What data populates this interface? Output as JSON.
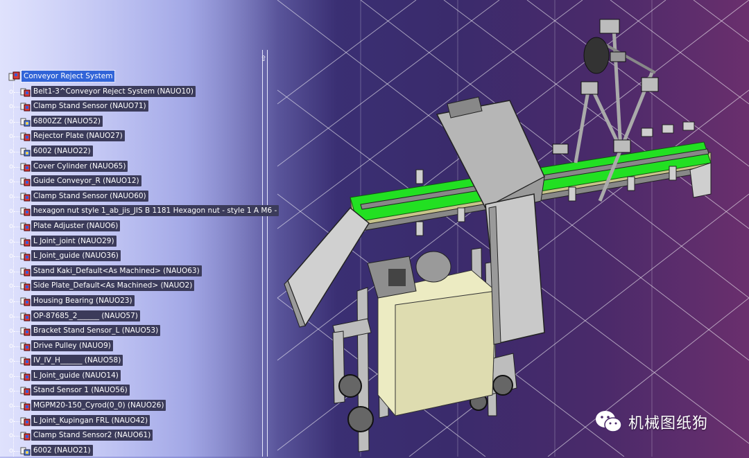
{
  "tree": {
    "root": "Conveyor Reject System",
    "items": [
      {
        "label": "Belt1-3^Conveyor Reject System (NAUO10)",
        "icon": "assembly"
      },
      {
        "label": "Clamp Stand Sensor (NAUO71)",
        "icon": "assembly"
      },
      {
        "label": "6800ZZ (NAUO52)",
        "icon": "part"
      },
      {
        "label": "Rejector Plate (NAUO27)",
        "icon": "assembly"
      },
      {
        "label": "6002 (NAUO22)",
        "icon": "part"
      },
      {
        "label": "Cover Cylinder (NAUO65)",
        "icon": "assembly"
      },
      {
        "label": "Guide Conveyor_R (NAUO12)",
        "icon": "assembly"
      },
      {
        "label": "Clamp Stand Sensor (NAUO60)",
        "icon": "assembly"
      },
      {
        "label": "hexagon nut style 1_ab_jis_JIS B 1181 Hexagon nut - style 1 A M6 -",
        "icon": "assembly"
      },
      {
        "label": "Plate Adjuster (NAUO6)",
        "icon": "assembly"
      },
      {
        "label": "L Joint_joint (NAUO29)",
        "icon": "assembly"
      },
      {
        "label": "L Joint_guide (NAUO36)",
        "icon": "assembly"
      },
      {
        "label": "Stand Kaki_Default<As Machined> (NAUO63)",
        "icon": "assembly"
      },
      {
        "label": "Side Plate_Default<As Machined> (NAUO2)",
        "icon": "assembly"
      },
      {
        "label": "Housing Bearing (NAUO23)",
        "icon": "assembly"
      },
      {
        "label": "OP-87685_2______ (NAUO57)",
        "icon": "assembly"
      },
      {
        "label": "Bracket Stand Sensor_L (NAUO53)",
        "icon": "assembly"
      },
      {
        "label": "Drive Pulley (NAUO9)",
        "icon": "assembly"
      },
      {
        "label": "IV_IV_H______ (NAUO58)",
        "icon": "assembly"
      },
      {
        "label": "L Joint_guide (NAUO14)",
        "icon": "assembly"
      },
      {
        "label": "Stand Sensor 1 (NAUO56)",
        "icon": "assembly"
      },
      {
        "label": "MGPM20-150_Cyrod(0_0) (NAUO26)",
        "icon": "assembly"
      },
      {
        "label": "L Joint_Kupingan FRL (NAUO42)",
        "icon": "assembly"
      },
      {
        "label": "Clamp Stand Sensor2 (NAUO61)",
        "icon": "assembly"
      },
      {
        "label": "6002 (NAUO21)",
        "icon": "part"
      }
    ]
  },
  "watermark": {
    "text": "机械图纸狗",
    "icon": "wechat-icon"
  },
  "colors": {
    "belt": "#22e022",
    "selection": "#3164d8",
    "label_bg": "#3b3b5a"
  }
}
